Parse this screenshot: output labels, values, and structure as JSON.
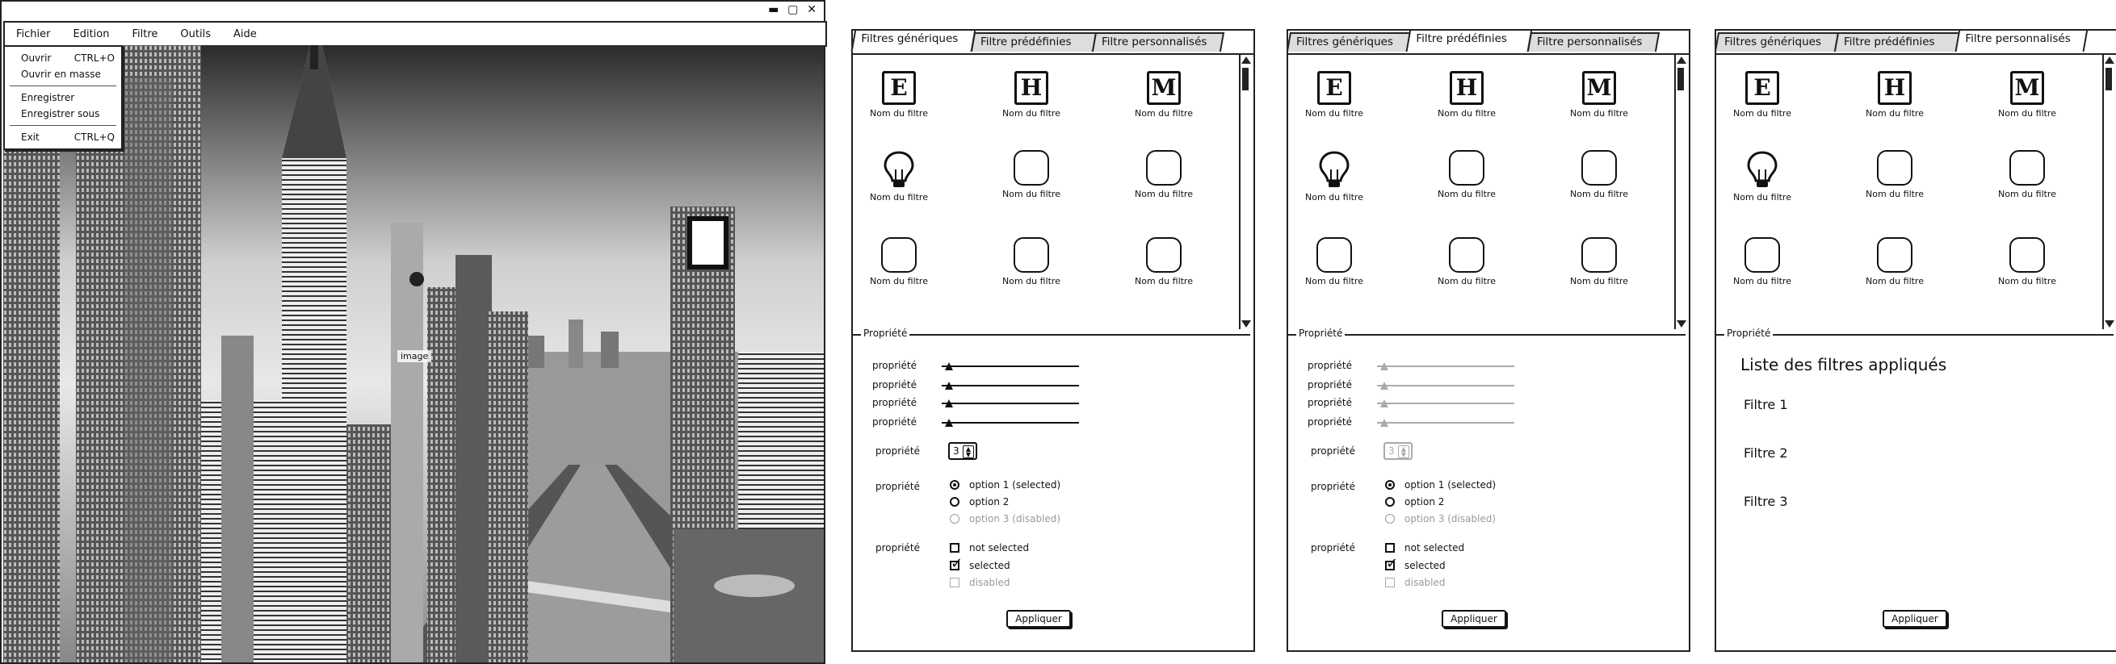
{
  "window": {
    "controls": "▬ ▢ ✕"
  },
  "menubar": {
    "items": [
      "Fichier",
      "Edition",
      "Filtre",
      "Outils",
      "Aide"
    ]
  },
  "file_menu": {
    "items": [
      {
        "label": "Ouvrir",
        "shortcut": "CTRL+O"
      },
      {
        "label": "Ouvrir en masse",
        "shortcut": ""
      },
      {
        "label": "Enregistrer",
        "shortcut": ""
      },
      {
        "label": "Enregistrer sous",
        "shortcut": ""
      },
      {
        "label": "Exit",
        "shortcut": "CTRL+Q"
      }
    ]
  },
  "image": {
    "caption": "image"
  },
  "tabs": [
    "Filtres génériques",
    "Filtre prédéfinies",
    "Filtre personnalisés"
  ],
  "filters": {
    "items": [
      {
        "icon": "letter",
        "letter": "E",
        "label": "Nom du filtre"
      },
      {
        "icon": "letter",
        "letter": "H",
        "label": "Nom du filtre"
      },
      {
        "icon": "letter",
        "letter": "M",
        "label": "Nom du filtre"
      },
      {
        "icon": "bulb",
        "letter": "",
        "label": "Nom du filtre"
      },
      {
        "icon": "blank",
        "letter": "",
        "label": "Nom du filtre"
      },
      {
        "icon": "blank",
        "letter": "",
        "label": "Nom du filtre"
      },
      {
        "icon": "blank",
        "letter": "",
        "label": "Nom du filtre"
      },
      {
        "icon": "blank",
        "letter": "",
        "label": "Nom du filtre"
      },
      {
        "icon": "blank",
        "letter": "",
        "label": "Nom du filtre"
      }
    ]
  },
  "properties": {
    "title": "Propriété",
    "label": "propriété",
    "sliders": [
      0.02,
      0.02,
      0.02,
      0.02
    ],
    "stepper_value": "3",
    "radio_options": [
      "option 1 (selected)",
      "option 2",
      "option 3 (disabled)"
    ],
    "checkbox_options": [
      "not selected",
      "selected",
      "disabled"
    ],
    "apply_label": "Appliquer"
  },
  "applied": {
    "title": "Liste des filtres appliqués",
    "items": [
      "Filtre 1",
      "Filtre 2",
      "Filtre 3"
    ]
  }
}
